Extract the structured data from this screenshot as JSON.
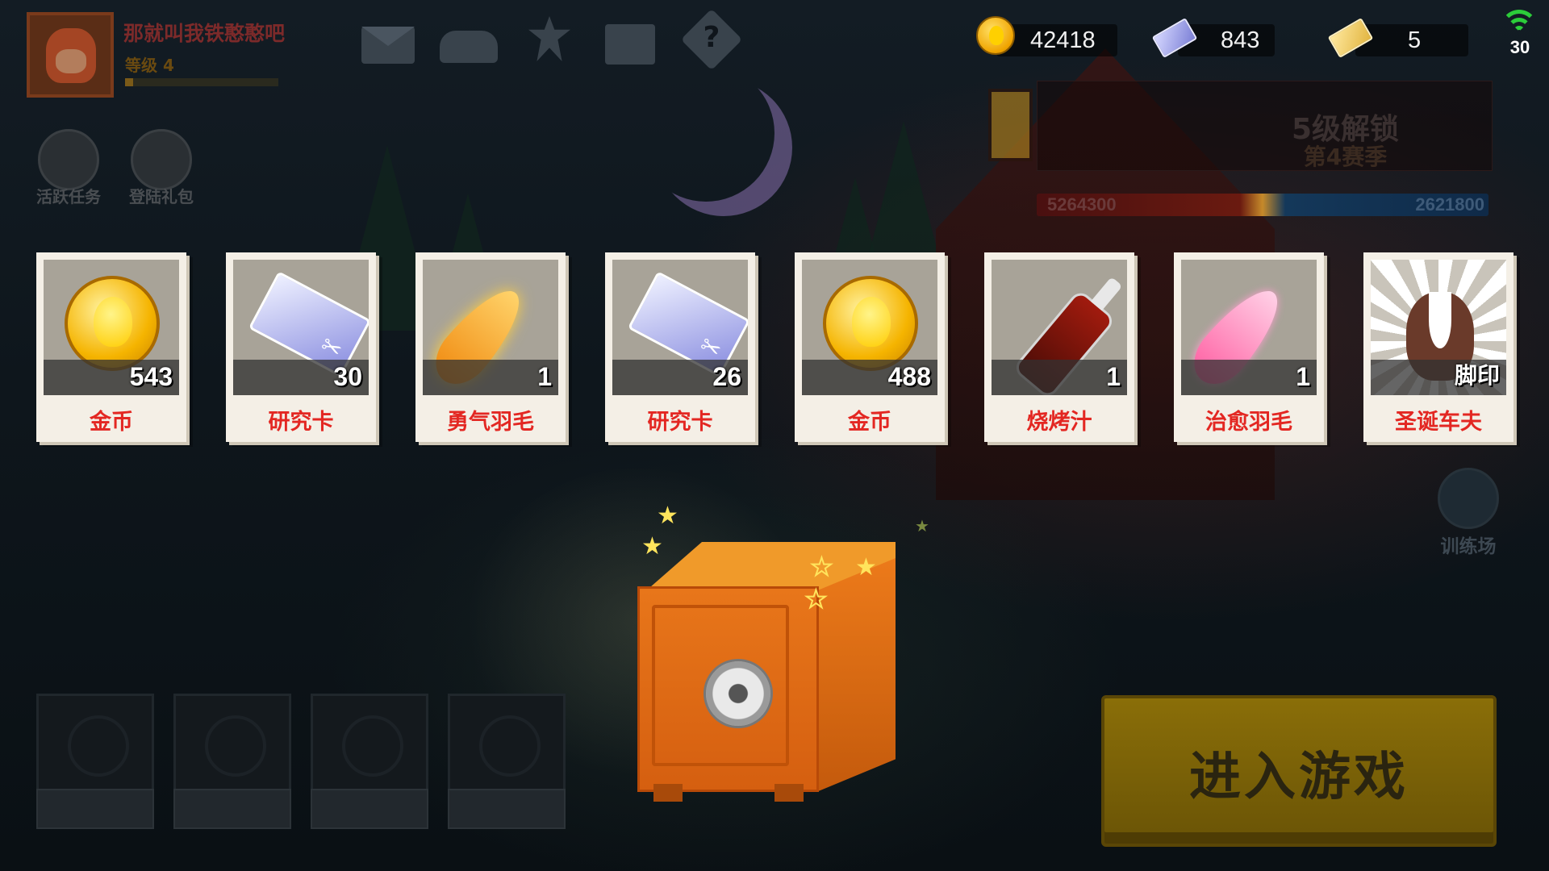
{
  "player": {
    "name": "那就叫我铁憨憨吧",
    "level_label": "等级 4",
    "xp_progress": 0.05
  },
  "top_icons": [
    "mail-icon",
    "friends-icon",
    "rank-icon",
    "calendar-icon",
    "help-icon"
  ],
  "currencies": {
    "gold": "42418",
    "research_cards": "843",
    "tickets": "5"
  },
  "fps": "30",
  "side_buttons": {
    "daily_tasks": "活跃任务",
    "login_gift": "登陆礼包"
  },
  "season": {
    "title": "5级解锁",
    "subtitle": "第4赛季",
    "score_left": "5264300",
    "score_right": "2621800"
  },
  "training_ground": "训练场",
  "rewards": [
    {
      "name": "金币",
      "count": "543",
      "icon": "gold-coin-icon"
    },
    {
      "name": "研究卡",
      "count": "30",
      "icon": "research-card-icon"
    },
    {
      "name": "勇气羽毛",
      "count": "1",
      "icon": "courage-feather-icon"
    },
    {
      "name": "研究卡",
      "count": "26",
      "icon": "research-card-icon"
    },
    {
      "name": "金币",
      "count": "488",
      "icon": "gold-coin-icon"
    },
    {
      "name": "烧烤汁",
      "count": "1",
      "icon": "bbq-sauce-icon"
    },
    {
      "name": "治愈羽毛",
      "count": "1",
      "icon": "healing-feather-icon"
    },
    {
      "name": "圣诞车夫",
      "count": "脚印",
      "icon": "footprint-icon"
    }
  ],
  "enter_game": "进入游戏",
  "colors": {
    "reward_name": "#e32722",
    "signal": "#2ccc3a",
    "safe": "#e8761a"
  }
}
